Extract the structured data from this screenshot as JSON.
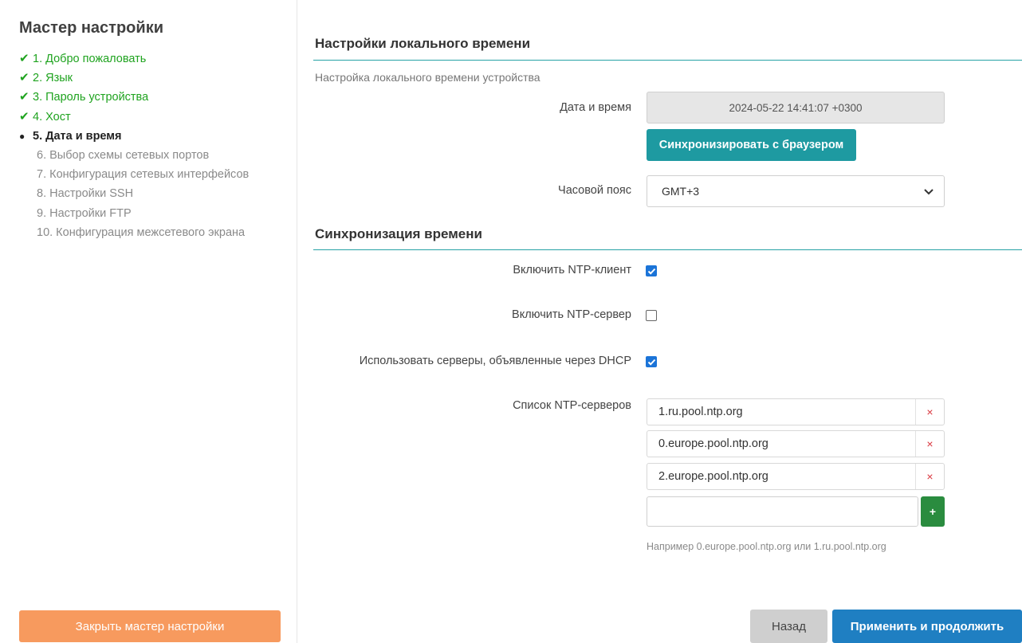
{
  "sidebar": {
    "title": "Мастер настройки",
    "steps": [
      {
        "label": "1. Добро пожаловать",
        "state": "done",
        "mark": "✔"
      },
      {
        "label": "2. Язык",
        "state": "done",
        "mark": "✔"
      },
      {
        "label": "3. Пароль устройства",
        "state": "done",
        "mark": "✔"
      },
      {
        "label": "4. Хост",
        "state": "done",
        "mark": "✔"
      },
      {
        "label": "5. Дата и время",
        "state": "current",
        "mark": "●"
      },
      {
        "label": "6. Выбор схемы сетевых портов",
        "state": "pending",
        "mark": ""
      },
      {
        "label": "7. Конфигурация сетевых интерфейсов",
        "state": "pending",
        "mark": ""
      },
      {
        "label": "8. Настройки SSH",
        "state": "pending",
        "mark": ""
      },
      {
        "label": "9. Настройки FTP",
        "state": "pending",
        "mark": ""
      },
      {
        "label": "10. Конфигурация межсетевого экрана",
        "state": "pending",
        "mark": ""
      }
    ],
    "close_label": "Закрыть мастер настройки"
  },
  "local_time": {
    "title": "Настройки локального времени",
    "description": "Настройка локального времени устройства",
    "datetime_label": "Дата и время",
    "datetime_value": "2024-05-22 14:41:07 +0300",
    "sync_label": "Синхронизировать с браузером",
    "timezone_label": "Часовой пояс",
    "timezone_value": "GMT+3"
  },
  "time_sync": {
    "title": "Синхронизация времени",
    "ntp_client_label": "Включить NTP-клиент",
    "ntp_client_checked": true,
    "ntp_server_label": "Включить NTP-сервер",
    "ntp_server_checked": false,
    "dhcp_label": "Использовать серверы, объявленные через DHCP",
    "dhcp_checked": true,
    "ntp_list_label": "Список NTP-серверов",
    "ntp_servers": [
      "1.ru.pool.ntp.org",
      "0.europe.pool.ntp.org",
      "2.europe.pool.ntp.org"
    ],
    "new_server_value": "",
    "remove_symbol": "×",
    "add_symbol": "+",
    "hint": "Например 0.europe.pool.ntp.org или 1.ru.pool.ntp.org"
  },
  "footer": {
    "back_label": "Назад",
    "apply_label": "Применить и продолжить"
  },
  "colors": {
    "done": "#1fa31f",
    "accent_line": "#26a2a5",
    "sync_button": "#1e9aa1",
    "close_button": "#f79a5e",
    "apply_button": "#1f7fc2",
    "add_button": "#2a8c3f",
    "checkbox": "#1b74d8",
    "remove": "#d9363e"
  }
}
